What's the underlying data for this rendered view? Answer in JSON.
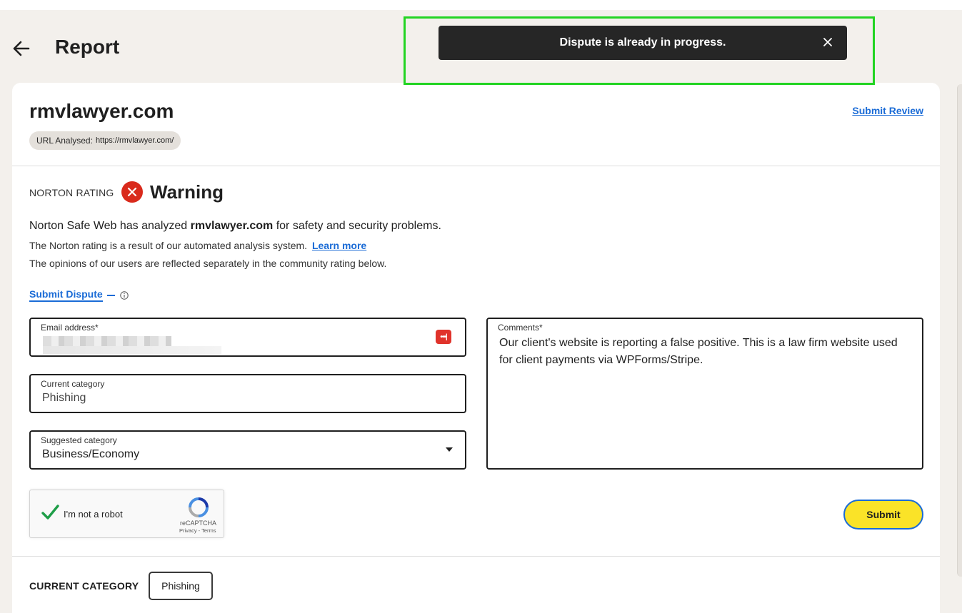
{
  "header": {
    "title": "Report"
  },
  "toast": {
    "message": "Dispute is already in progress."
  },
  "site": {
    "domain": "rmvlawyer.com",
    "url_label": "URL Analysed:",
    "url_value": "https://rmvlawyer.com/",
    "submit_review": "Submit Review"
  },
  "rating": {
    "label": "NORTON RATING",
    "value": "Warning",
    "color": "#d92a1c"
  },
  "analysis": {
    "prefix": "Norton Safe Web has analyzed ",
    "domain": "rmvlawyer.com",
    "suffix": " for safety and security problems.",
    "note1": "The Norton rating is a result of our automated analysis system.",
    "learn_more": "Learn more",
    "note2": "The opinions of our users are reflected separately in the community rating below."
  },
  "dispute": {
    "toggle_label": "Submit Dispute",
    "email_label": "Email address*",
    "current_category_label": "Current category",
    "current_category_value": "Phishing",
    "suggested_category_label": "Suggested category",
    "suggested_category_value": "Business/Economy",
    "comments_label": "Comments*",
    "comments_value": "Our client's website is reporting a false positive. This is a law firm website used for client payments via WPForms/Stripe.",
    "submit_label": "Submit"
  },
  "captcha": {
    "label": "I'm not a robot",
    "brand": "reCAPTCHA",
    "links": "Privacy - Terms"
  },
  "category": {
    "label": "CURRENT CATEGORY",
    "value": "Phishing"
  },
  "colors": {
    "link": "#1a6bd6",
    "submit_bg": "#fae328",
    "toast_bg": "#262626",
    "highlight": "#22d422"
  }
}
